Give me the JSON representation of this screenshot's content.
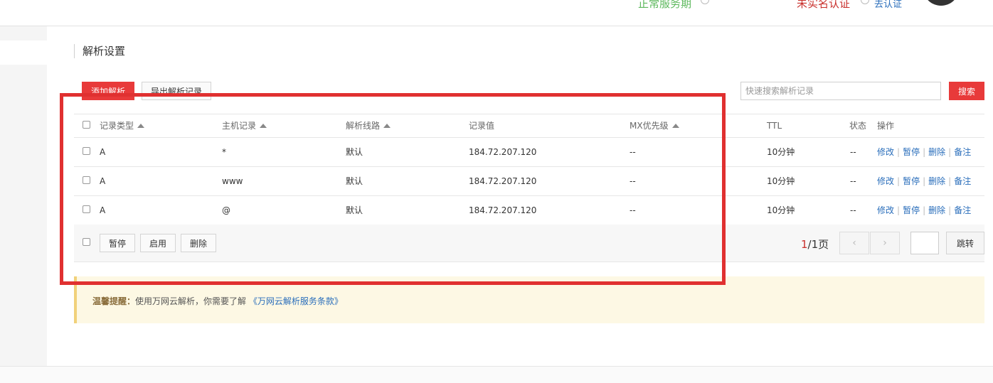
{
  "top": {
    "service_status": "正常服务期",
    "auth_status": "未实名认证",
    "auth_link": "去认证"
  },
  "section": {
    "title": "解析设置"
  },
  "toolbar": {
    "add_label": "添加解析",
    "export_label": "导出解析记录",
    "search_placeholder": "快速搜索解析记录",
    "search_label": "搜索"
  },
  "table": {
    "headers": {
      "type": "记录类型",
      "host": "主机记录",
      "line": "解析线路",
      "value": "记录值",
      "mx": "MX优先级",
      "ttl": "TTL",
      "status": "状态",
      "ops": "操作"
    },
    "rows": [
      {
        "type": "A",
        "host": "*",
        "line": "默认",
        "value": "184.72.207.120",
        "mx": "--",
        "ttl": "10分钟",
        "status": "--"
      },
      {
        "type": "A",
        "host": "www",
        "line": "默认",
        "value": "184.72.207.120",
        "mx": "--",
        "ttl": "10分钟",
        "status": "--"
      },
      {
        "type": "A",
        "host": "@",
        "line": "默认",
        "value": "184.72.207.120",
        "mx": "--",
        "ttl": "10分钟",
        "status": "--"
      }
    ],
    "actions": {
      "edit": "修改",
      "pause": "暂停",
      "delete": "删除",
      "note": "备注",
      "separator": "|"
    }
  },
  "batch": {
    "pause_label": "暂停",
    "enable_label": "启用",
    "delete_label": "删除"
  },
  "pagination": {
    "current": "1",
    "total_text": "/1页",
    "prev_icon": "‹",
    "next_icon": "›",
    "jump_label": "跳转"
  },
  "notice": {
    "label": "温馨提醒：",
    "text": "使用万网云解析，你需要了解",
    "link": "《万网云解析服务条款》"
  },
  "colors": {
    "accent_red": "#e83a3a",
    "highlight_border": "#e03030",
    "link_blue": "#2a6ebb",
    "status_green": "#5cb85c"
  }
}
